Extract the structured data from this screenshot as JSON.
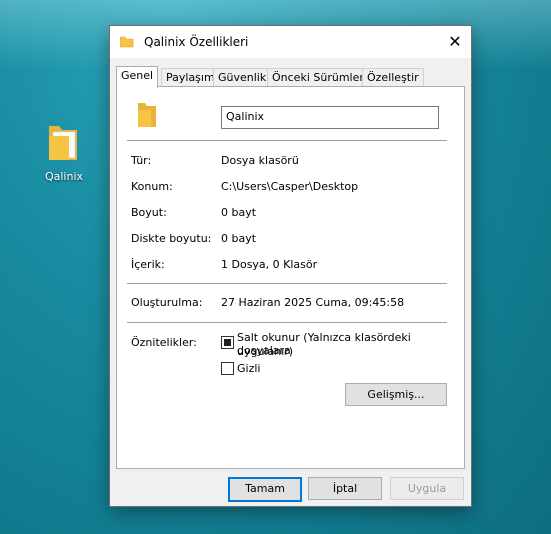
{
  "desktop": {
    "icon_label": "Qalinix"
  },
  "window": {
    "title": "Qalinix Özellikleri",
    "close_glyph": "✕"
  },
  "tabs": [
    {
      "label": "Genel"
    },
    {
      "label": "Paylaşım"
    },
    {
      "label": "Güvenlik"
    },
    {
      "label": "Önceki Sürümler"
    },
    {
      "label": "Özelleştir"
    }
  ],
  "general": {
    "name_value": "Qalinix",
    "type_label": "Tür:",
    "type_value": "Dosya klasörü",
    "location_label": "Konum:",
    "location_value": "C:\\Users\\Casper\\Desktop",
    "size_label": "Boyut:",
    "size_value": "0 bayt",
    "size_on_disk_label": "Diskte boyutu:",
    "size_on_disk_value": "0 bayt",
    "contents_label": "İçerik:",
    "contents_value": "1 Dosya, 0 Klasör",
    "created_label": "Oluşturulma:",
    "created_value": "27 Haziran 2025 Cuma, 09:45:58",
    "attributes_label": "Öznitelikler:",
    "readonly_label_line1": "Salt okunur (Yalnızca klasördeki dosyalara",
    "readonly_label_line2": "uygulanır)",
    "hidden_label": "Gizli",
    "advanced_button": "Gelişmiş..."
  },
  "footer": {
    "ok": "Tamam",
    "cancel": "İptal",
    "apply": "Uygula"
  },
  "colors": {
    "folder_yellow": "#f6c445",
    "accent": "#0078d7"
  }
}
